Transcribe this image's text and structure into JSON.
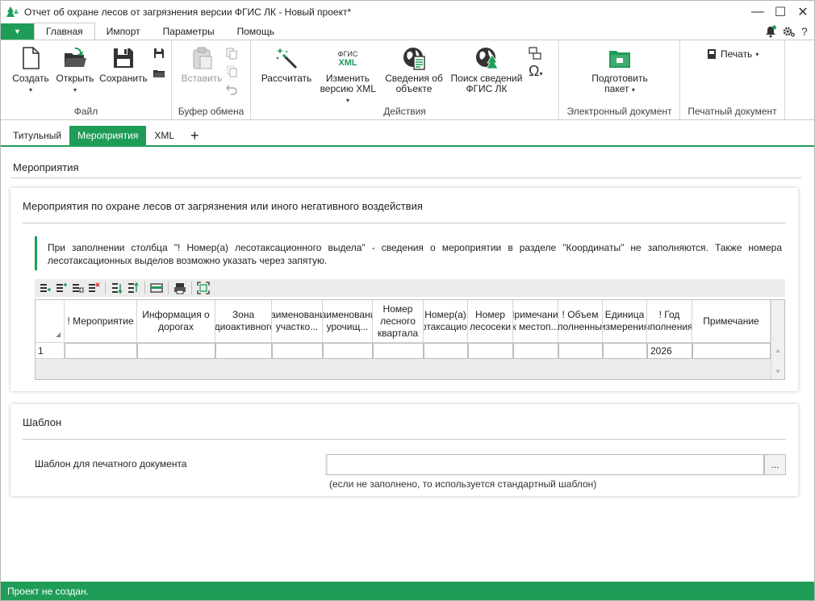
{
  "window": {
    "title": "Отчет об охране лесов от загрязнения версии ФГИС ЛК - Новый проект*",
    "minimize": "—",
    "maximize": "☐",
    "close": "✕"
  },
  "ribbon_tabs": {
    "file": "▼",
    "items": [
      "Главная",
      "Импорт",
      "Параметры",
      "Помощь"
    ],
    "active": "Главная"
  },
  "ribbon_right_icons": [
    "bell-icon",
    "gear-icon",
    "help-icon"
  ],
  "ribbon_groups": {
    "file": {
      "label": "Файл",
      "create": "Создать",
      "open": "Открыть",
      "save": "Сохранить",
      "caret": "▾"
    },
    "clipboard": {
      "label": "Буфер обмена",
      "paste": "Вставить"
    },
    "actions": {
      "label": "Действия",
      "calculate": "Рассчитать",
      "xml_logo_top": "ФГИС",
      "xml_logo_bottom": "XML",
      "change_xml_1": "Изменить",
      "change_xml_2": "версию XML",
      "object_info_1": "Сведения об",
      "object_info_2": "объекте",
      "search_1": "Поиск сведений",
      "search_2": "ФГИС ЛК",
      "omega": "Ω"
    },
    "edoc": {
      "label": "Электронный документ",
      "prepare_1": "Подготовить",
      "prepare_2": "пакет"
    },
    "print": {
      "label": "Печатный документ",
      "print": "Печать"
    }
  },
  "doc_tabs": {
    "items": [
      "Титульный",
      "Мероприятия",
      "XML"
    ],
    "active": "Мероприятия",
    "add": "+"
  },
  "section": {
    "title": "Мероприятия"
  },
  "card_events": {
    "title": "Мероприятия по охране лесов от загрязнения или иного негативного воздействия",
    "hint": "При заполнении столбца \"! Номер(а) лесотаксационного выдела\" - сведения о мероприятии в разделе \"Координаты\" не заполняются. Также номера лесотаксационных выделов возможно указать через запятую.",
    "columns": [
      "! Мероприятие",
      "Информация о дорогах",
      "Зона радиоактивного...",
      "Наименование участко...",
      "Наименование урочищ...",
      "Номер лесного квартала",
      "Номер(а) лесотаксационн...",
      "Номер лесосеки",
      "Примечание к местоп...",
      "! Объем выполненных...",
      "Единица измерения",
      "! Год выполнения...",
      "Примечание"
    ],
    "rows": [
      {
        "num": "1",
        "cells": [
          "",
          "",
          "",
          "",
          "",
          "",
          "",
          "",
          "",
          "",
          "",
          "2026",
          ""
        ]
      }
    ]
  },
  "card_template": {
    "title": "Шаблон",
    "label": "Шаблон для печатного документа",
    "value": "",
    "browse": "...",
    "note": "(если не заполнено, то используется стандартный шаблон)"
  },
  "status": {
    "text": "Проект не создан."
  },
  "colors": {
    "accent": "#1f9d58"
  }
}
